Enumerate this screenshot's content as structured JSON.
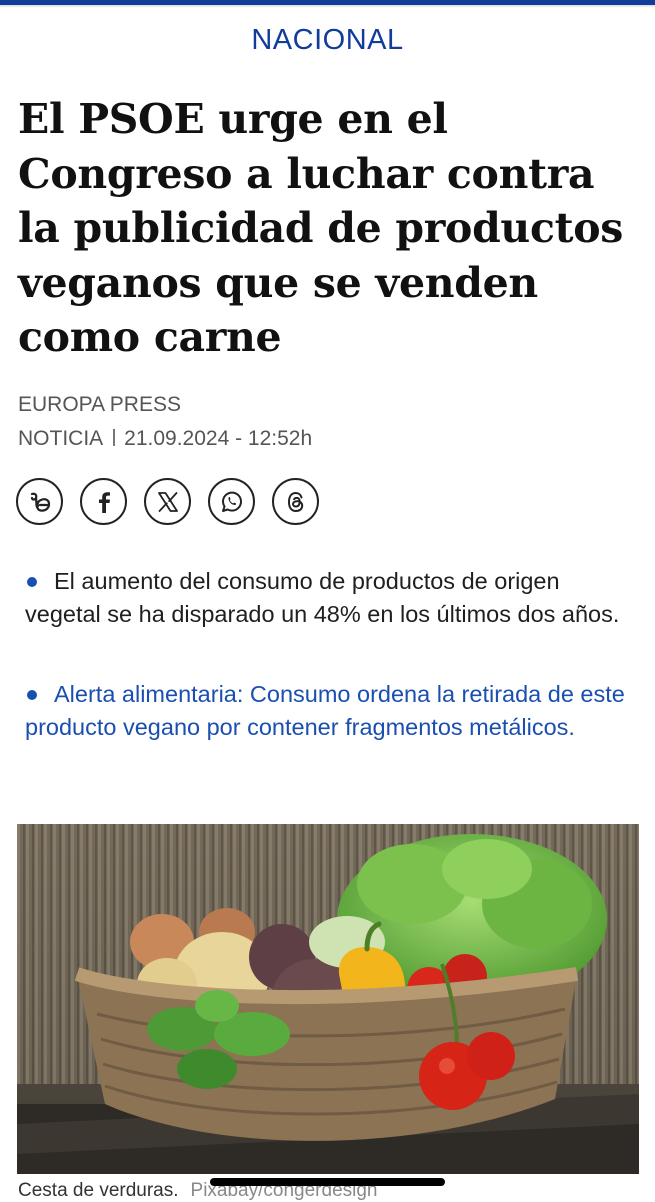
{
  "section": {
    "label": "NACIONAL"
  },
  "article": {
    "title": "El PSOE urge en el Congreso a luchar contra la publicidad de productos veganos que se venden como carne",
    "source": "EUROPA PRESS",
    "type": "NOTICIA",
    "datetime": "21.09.2024 - 12:52h"
  },
  "share": {
    "buttons": [
      {
        "icon": "bluesky-like-icon"
      },
      {
        "icon": "facebook-icon"
      },
      {
        "icon": "x-twitter-icon"
      },
      {
        "icon": "whatsapp-icon"
      },
      {
        "icon": "threads-icon"
      }
    ]
  },
  "related": [
    {
      "text": "El aumento del consumo de productos de origen vegetal se ha disparado un 48% en los últimos dos años.",
      "linked": false
    },
    {
      "text": "Alerta alimentaria: Consumo ordena la retirada de este producto vegano por contener fragmentos metálicos.",
      "linked": true
    }
  ],
  "image": {
    "caption": "Cesta de verduras.",
    "credit": "Pixabay/congerdesign"
  },
  "colors": {
    "brand": "#123c9c",
    "link": "#1a4fb0",
    "text": "#111111",
    "meta": "#555555"
  }
}
